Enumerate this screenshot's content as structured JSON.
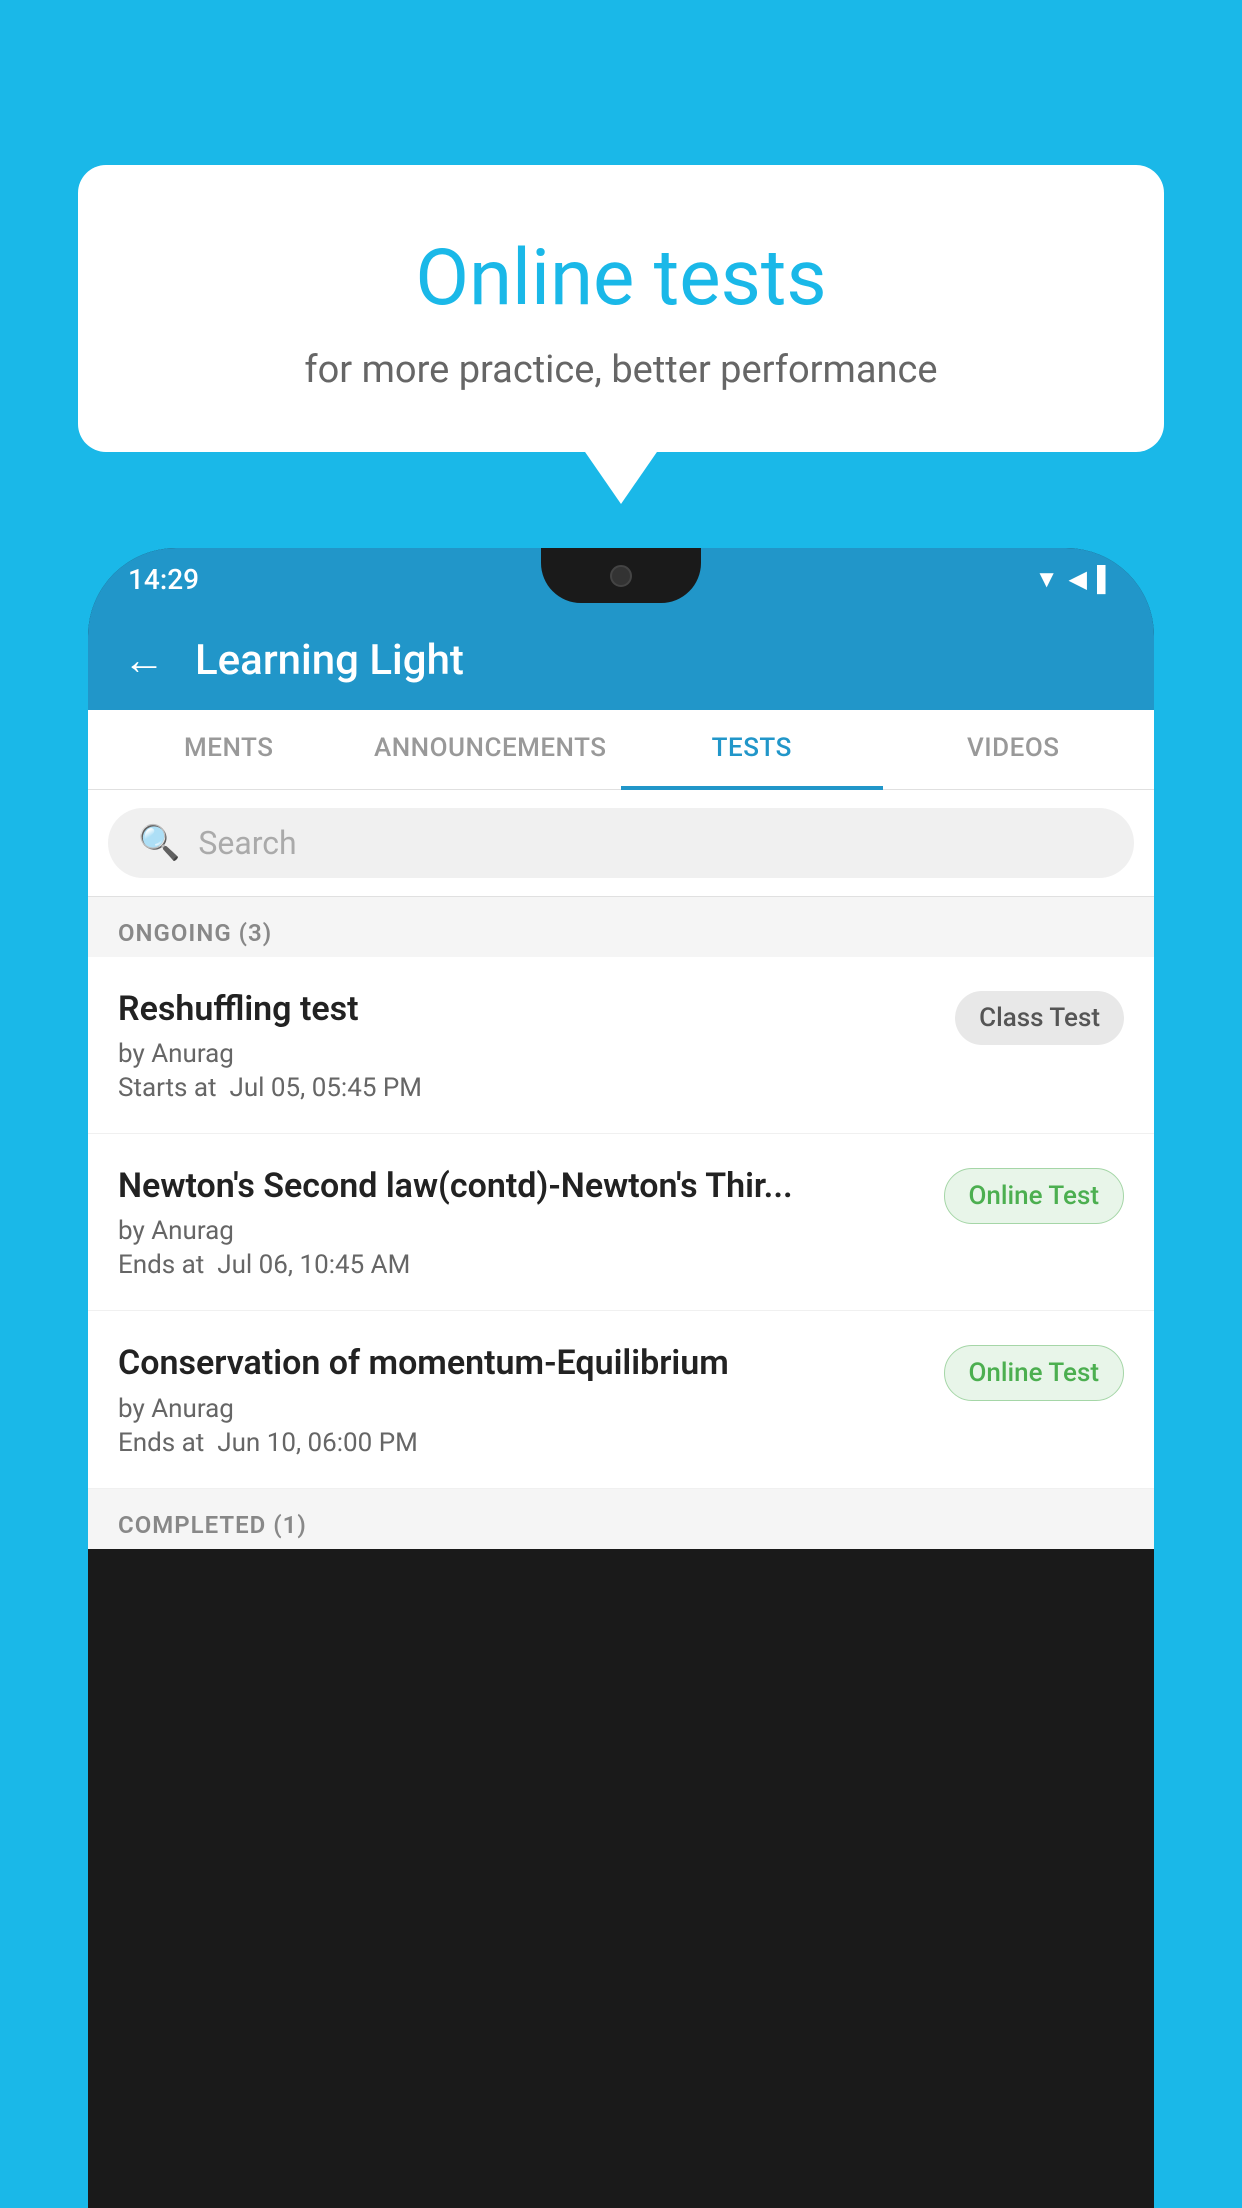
{
  "background": {
    "color": "#1ab8e8"
  },
  "promo": {
    "title": "Online tests",
    "subtitle": "for more practice, better performance"
  },
  "phone": {
    "status_bar": {
      "time": "14:29",
      "icons": [
        "▼",
        "▲",
        "▌"
      ]
    },
    "header": {
      "title": "Learning Light",
      "back_label": "←"
    },
    "tabs": [
      {
        "label": "MENTS",
        "active": false
      },
      {
        "label": "ANNOUNCEMENTS",
        "active": false
      },
      {
        "label": "TESTS",
        "active": true
      },
      {
        "label": "VIDEOS",
        "active": false
      }
    ],
    "search": {
      "placeholder": "Search"
    },
    "ongoing_label": "ONGOING (3)",
    "tests": [
      {
        "name": "Reshuffling test",
        "by": "by Anurag",
        "date_label": "Starts at",
        "date": "Jul 05, 05:45 PM",
        "badge": "Class Test",
        "badge_type": "class"
      },
      {
        "name": "Newton's Second law(contd)-Newton's Thir...",
        "by": "by Anurag",
        "date_label": "Ends at",
        "date": "Jul 06, 10:45 AM",
        "badge": "Online Test",
        "badge_type": "online"
      },
      {
        "name": "Conservation of momentum-Equilibrium",
        "by": "by Anurag",
        "date_label": "Ends at",
        "date": "Jun 10, 06:00 PM",
        "badge": "Online Test",
        "badge_type": "online"
      }
    ],
    "completed_label": "COMPLETED (1)"
  }
}
